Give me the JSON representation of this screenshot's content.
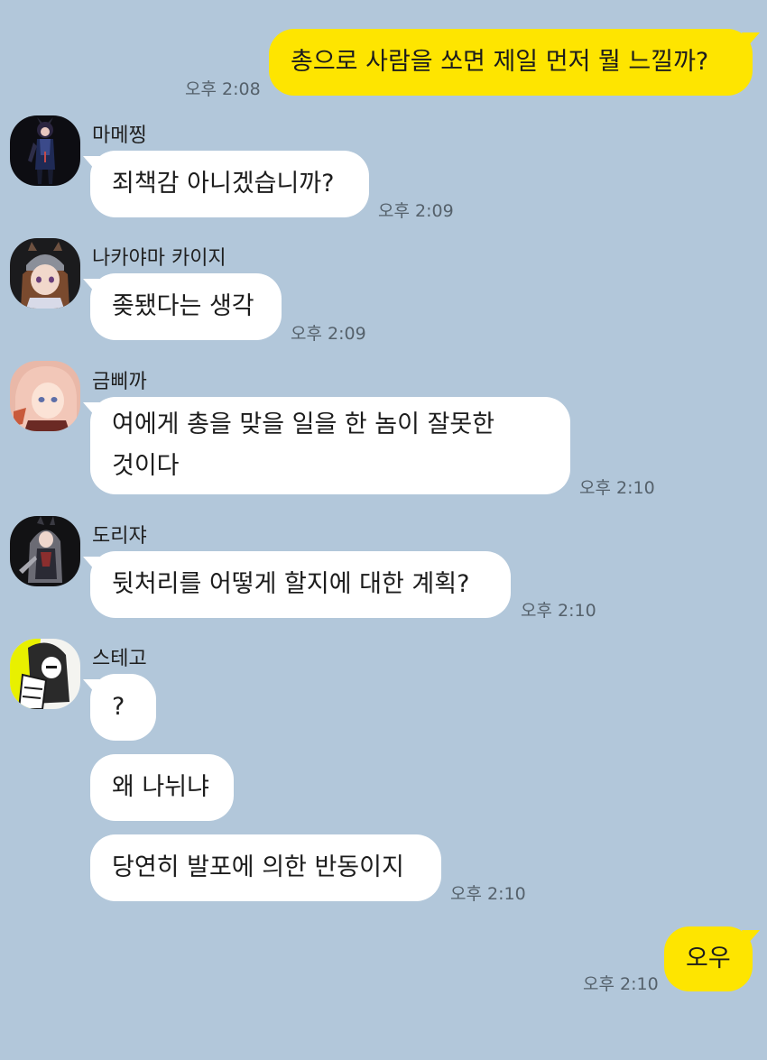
{
  "colors": {
    "background": "#b2c7da",
    "my_bubble": "#fee500",
    "other_bubble": "#ffffff",
    "time_text": "#55616b"
  },
  "messages": [
    {
      "side": "me",
      "text": "총으로 사람을 쏘면 제일 먼저 뭘 느낄까?",
      "time": "오후 2:08"
    },
    {
      "side": "other",
      "sender": "마메찡",
      "text": "죄책감 아니겠습니까?",
      "time": "오후 2:09"
    },
    {
      "side": "other",
      "sender": "나카야마 카이지",
      "text": "좆됐다는 생각",
      "time": "오후 2:09"
    },
    {
      "side": "other",
      "sender": "금삐까",
      "text_lines": [
        "여에게 총을 맞을 일을 한 놈이 잘못한",
        "것이다"
      ],
      "time": "오후 2:10"
    },
    {
      "side": "other",
      "sender": "도리쟈",
      "text": "뒷처리를 어떻게 할지에 대한 계획?",
      "time": "오후 2:10"
    },
    {
      "side": "other",
      "sender": "스테고",
      "texts": [
        "?",
        "왜 나뉘냐",
        "당연히 발포에 의한 반동이지"
      ],
      "time": "오후 2:10"
    },
    {
      "side": "me",
      "text": "오우",
      "time": "오후 2:10"
    }
  ]
}
